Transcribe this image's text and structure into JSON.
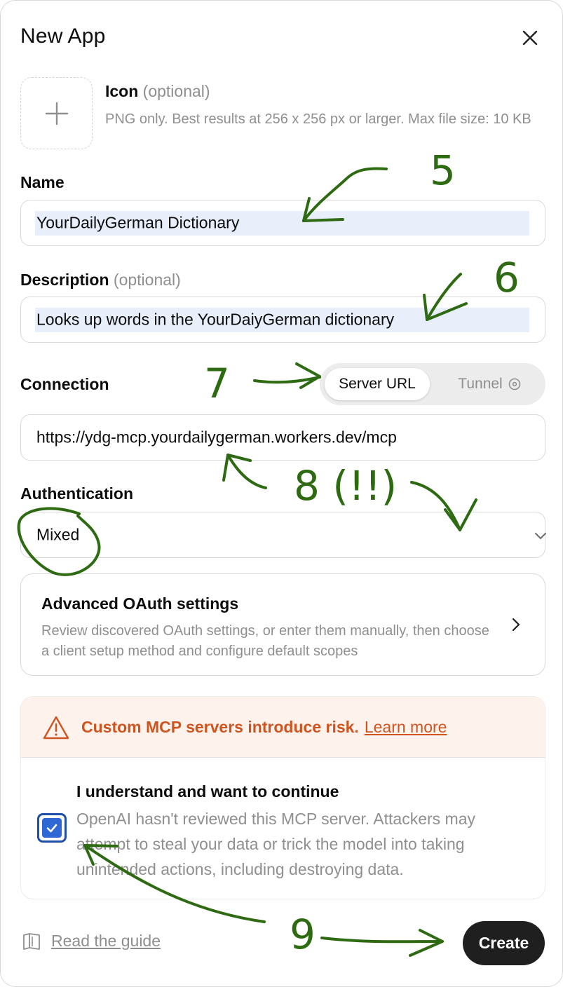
{
  "dialog": {
    "title": "New App",
    "close_icon": "close-icon"
  },
  "icon_field": {
    "label": "Icon",
    "optional": "(optional)",
    "help": "PNG only. Best results at 256 x 256 px or larger. Max file size: 10 KB",
    "icon": "plus-icon"
  },
  "name_field": {
    "label": "Name",
    "value": "YourDailyGerman Dictionary"
  },
  "description_field": {
    "label": "Description",
    "optional": "(optional)",
    "value": "Looks up words in the YourDaiyGerman dictionary"
  },
  "connection": {
    "label": "Connection",
    "options": [
      "Server URL",
      "Tunnel"
    ],
    "selected": "Server URL",
    "help_icon": "help-circle-icon",
    "url": "https://ydg-mcp.yourdailygerman.workers.dev/mcp"
  },
  "authentication": {
    "label": "Authentication",
    "selected": "Mixed",
    "chevron_icon": "chevron-down-icon"
  },
  "oauth_card": {
    "title": "Advanced OAuth settings",
    "description": "Review discovered OAuth settings, or enter them manually, then choose a client setup method and configure default scopes",
    "arrow_icon": "chevron-right-icon"
  },
  "risk": {
    "text": "Custom MCP servers introduce risk.",
    "link": "Learn more",
    "warn_icon": "warning-icon",
    "accent": "#d0541f",
    "background": "#fdf2ec"
  },
  "acknowledge": {
    "title": "I understand and want to continue",
    "description": "OpenAI hasn't reviewed this MCP server. Attackers may attempt to steal your data or trick the model into taking unintended actions, including destroying data.",
    "checked": true
  },
  "footer": {
    "guide_label": "Read the guide",
    "guide_icon": "book-icon",
    "create_label": "Create"
  },
  "annotations": {
    "color": "#2d6a12",
    "labels": [
      "5",
      "6",
      "7",
      "8 (!!)",
      "9"
    ]
  }
}
